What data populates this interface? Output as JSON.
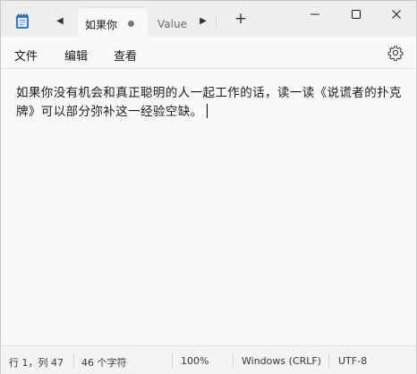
{
  "tabs": [
    {
      "label": "如果你"
    },
    {
      "label": "Value"
    }
  ],
  "menu": {
    "file": "文件",
    "edit": "编辑",
    "view": "查看"
  },
  "editor": {
    "text": "如果你没有机会和真正聪明的人一起工作的话，读一读《说谎者的扑克牌》可以部分弥补这一经验空缺。"
  },
  "status": {
    "position": "行 1，列 47",
    "chars": "46 个字符",
    "zoom": "100%",
    "line_ending": "Windows (CRLF)",
    "encoding": "UTF-8"
  },
  "icons": {
    "app": "notepad-icon",
    "settings": "gear-icon",
    "minimize": "minimize-icon",
    "maximize": "maximize-icon",
    "close": "close-icon"
  },
  "colors": {
    "accent": "#1f6fd4",
    "titlebar": "#eeeeee",
    "editor_bg": "#f9f9f9",
    "statusbar": "#f3f3f3"
  }
}
